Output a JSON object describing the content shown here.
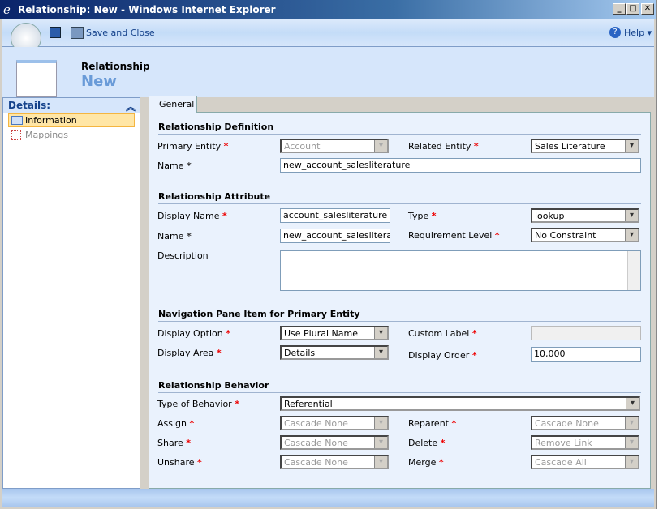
{
  "window": {
    "title": "Relationship: New - Windows Internet Explorer"
  },
  "toolbar": {
    "save_close": "Save and Close",
    "help": "Help"
  },
  "header": {
    "entity": "Relationship",
    "state": "New"
  },
  "nav": {
    "title": "Details:",
    "items": [
      {
        "label": "Information"
      },
      {
        "label": "Mappings"
      }
    ]
  },
  "tabs": [
    {
      "label": "General"
    }
  ],
  "sections": {
    "definition": {
      "title": "Relationship Definition",
      "primary_entity_label": "Primary Entity",
      "primary_entity": "Account",
      "related_entity_label": "Related Entity",
      "related_entity": "Sales Literature",
      "name_label": "Name",
      "name": "new_account_salesliterature"
    },
    "attribute": {
      "title": "Relationship Attribute",
      "display_name_label": "Display Name",
      "display_name": "account_salesliterature",
      "type_label": "Type",
      "type": "lookup",
      "name_label": "Name",
      "name": "new_account_salesliteratur",
      "req_level_label": "Requirement Level",
      "req_level": "No Constraint",
      "description_label": "Description",
      "description": ""
    },
    "navigation": {
      "title": "Navigation Pane Item for Primary Entity",
      "display_option_label": "Display Option",
      "display_option": "Use Plural Name",
      "custom_label_label": "Custom Label",
      "custom_label": "",
      "display_area_label": "Display Area",
      "display_area": "Details",
      "display_order_label": "Display Order",
      "display_order": "10,000"
    },
    "behavior": {
      "title": "Relationship Behavior",
      "type_label": "Type of Behavior",
      "type": "Referential",
      "assign_label": "Assign",
      "assign": "Cascade None",
      "reparent_label": "Reparent",
      "reparent": "Cascade None",
      "share_label": "Share",
      "share": "Cascade None",
      "delete_label": "Delete",
      "delete": "Remove Link",
      "unshare_label": "Unshare",
      "unshare": "Cascade None",
      "merge_label": "Merge",
      "merge": "Cascade All"
    }
  },
  "required_marker": "*"
}
